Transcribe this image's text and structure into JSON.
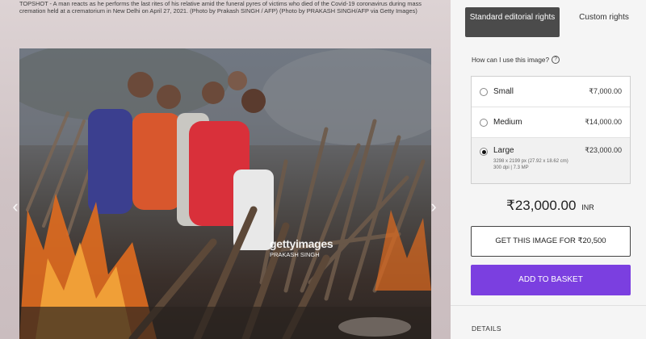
{
  "caption": "TOPSHOT - A man reacts as he performs the last rites of his relative amid the funeral pyres of victims who died of the Covid-19 coronavirus during mass cremation held at a crematorium in New Delhi on April 27, 2021. (Photo by Prakash SINGH / AFP) (Photo by PRAKASH SINGH/AFP via Getty Images)",
  "watermark": {
    "logo": "gettyimages",
    "credit": "PRAKASH SINGH"
  },
  "nav": {
    "prev": "‹",
    "next": "›"
  },
  "tabs": {
    "standard": "Standard editorial rights",
    "custom": "Custom rights"
  },
  "license_question": "How can I use this image?",
  "help_icon": "?",
  "options": [
    {
      "name": "Small",
      "price": "₹7,000.00",
      "selected": false
    },
    {
      "name": "Medium",
      "price": "₹14,000.00",
      "selected": false
    },
    {
      "name": "Large",
      "price": "₹23,000.00",
      "selected": true,
      "spec_line1": "3298 x 2199 px (27.92 x 18.62 cm)",
      "spec_line2": "300 dpi | 7.3 MP"
    }
  ],
  "selected_price": {
    "amount": "₹23,000.00",
    "currency": "INR"
  },
  "get_button": "GET THIS IMAGE FOR ₹20,500",
  "basket_button": "ADD TO BASKET",
  "details_heading": "DETAILS",
  "colors": {
    "accent": "#7b3fe0",
    "tab_active": "#4b4b4b"
  }
}
